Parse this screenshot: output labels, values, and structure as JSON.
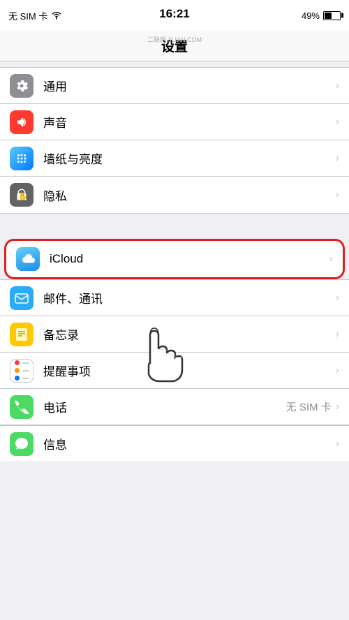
{
  "status_bar": {
    "left": "无 SIM 卡 ◈",
    "sim_label": "无 SIM 卡",
    "wifi_label": "WiFi",
    "time": "16:21",
    "battery_percent": "49%"
  },
  "watermark": "二联网 3LIAN.COM",
  "nav": {
    "title": "设置"
  },
  "sections": [
    {
      "id": "section1",
      "items": [
        {
          "id": "general",
          "label": "通用",
          "icon_color": "gray",
          "icon_char": "⚙",
          "value": ""
        },
        {
          "id": "sound",
          "label": "声音",
          "icon_color": "red",
          "icon_char": "🔊",
          "value": ""
        },
        {
          "id": "wallpaper",
          "label": "墙纸与亮度",
          "icon_color": "blue",
          "icon_char": "✦",
          "value": ""
        },
        {
          "id": "privacy",
          "label": "隐私",
          "icon_color": "darkgray",
          "icon_char": "✋",
          "value": ""
        }
      ]
    },
    {
      "id": "section2",
      "items": [
        {
          "id": "icloud",
          "label": "iCloud",
          "icon_color": "icloud",
          "icon_char": "☁",
          "value": "",
          "highlighted": true
        },
        {
          "id": "mail",
          "label": "邮件、通讯",
          "icon_color": "mail",
          "icon_char": "✉",
          "value": ""
        },
        {
          "id": "notes",
          "label": "备忘录",
          "icon_color": "notes",
          "icon_char": "≡",
          "value": ""
        },
        {
          "id": "reminders",
          "label": "提醒事项",
          "icon_color": "reminders",
          "icon_char": "●",
          "value": ""
        },
        {
          "id": "phone",
          "label": "电话",
          "icon_color": "phone",
          "icon_char": "✆",
          "value": "无 SIM 卡"
        },
        {
          "id": "messages",
          "label": "信息",
          "icon_color": "messages",
          "icon_char": "💬",
          "value": ""
        }
      ]
    }
  ],
  "chevron": "›"
}
